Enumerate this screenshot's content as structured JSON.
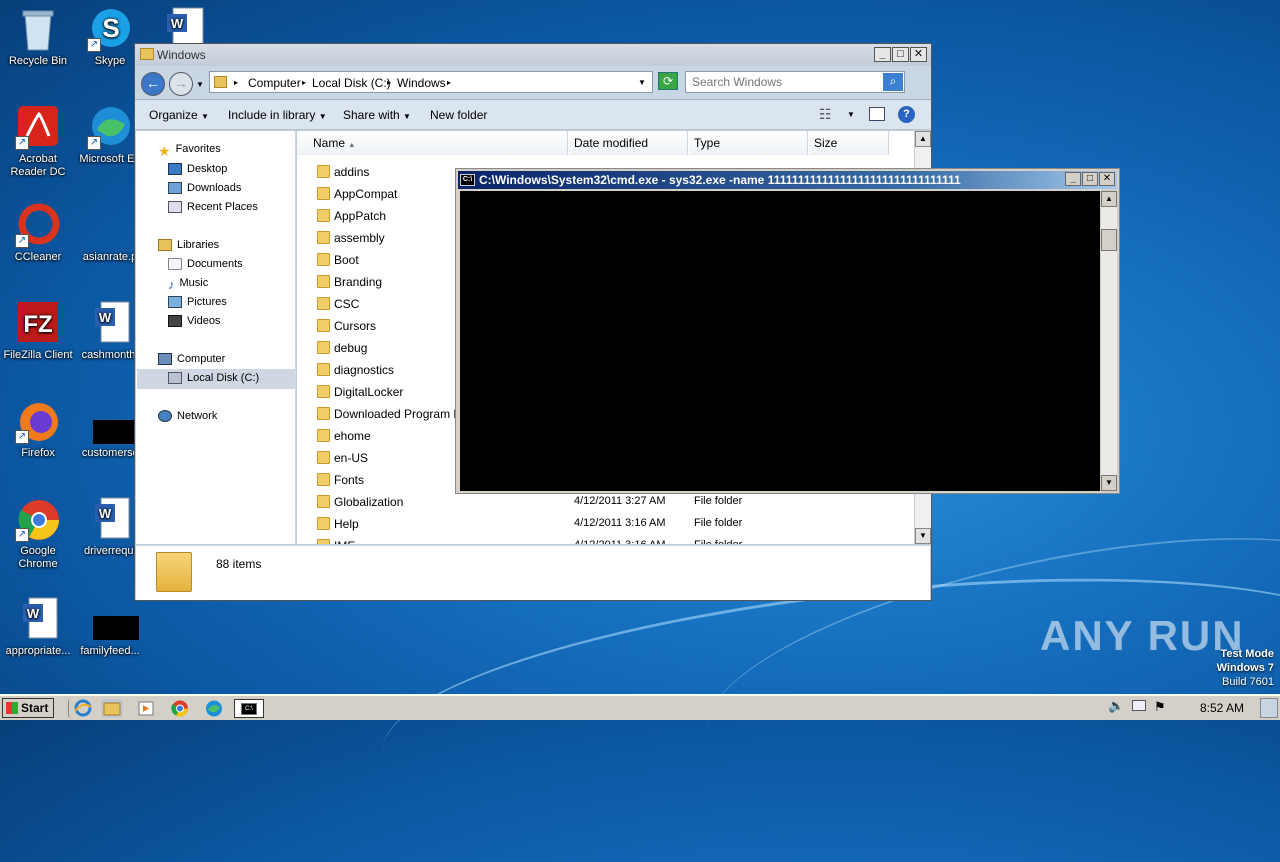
{
  "desktop": {
    "icons": [
      {
        "label": "Recycle Bin"
      },
      {
        "label": "Skype"
      },
      {
        "label": "Acrobat Reader DC"
      },
      {
        "label": "Microsoft Ed"
      },
      {
        "label": "CCleaner"
      },
      {
        "label": "asianrate.p"
      },
      {
        "label": "FileZilla Client"
      },
      {
        "label": "cashmonth."
      },
      {
        "label": "Firefox"
      },
      {
        "label": "customersc"
      },
      {
        "label": "Google Chrome"
      },
      {
        "label": "driverrequi"
      },
      {
        "label": "appropriate..."
      },
      {
        "label": "familyfeed..."
      }
    ]
  },
  "explorer": {
    "title": "Windows",
    "address": {
      "crumbs": [
        "Computer",
        "Local Disk (C:)",
        "Windows"
      ]
    },
    "search_placeholder": "Search Windows",
    "toolbar": {
      "organize": "Organize",
      "include": "Include in library",
      "share": "Share with",
      "new_folder": "New folder"
    },
    "nav": {
      "favorites": "Favorites",
      "desktop": "Desktop",
      "downloads": "Downloads",
      "recent": "Recent Places",
      "libraries": "Libraries",
      "documents": "Documents",
      "music": "Music",
      "pictures": "Pictures",
      "videos": "Videos",
      "computer": "Computer",
      "local_disk": "Local Disk (C:)",
      "network": "Network"
    },
    "columns": {
      "name": "Name",
      "date": "Date modified",
      "type": "Type",
      "size": "Size"
    },
    "files": [
      {
        "name": "addins",
        "date": "",
        "type": ""
      },
      {
        "name": "AppCompat",
        "date": "",
        "type": ""
      },
      {
        "name": "AppPatch",
        "date": "",
        "type": ""
      },
      {
        "name": "assembly",
        "date": "",
        "type": ""
      },
      {
        "name": "Boot",
        "date": "",
        "type": ""
      },
      {
        "name": "Branding",
        "date": "",
        "type": ""
      },
      {
        "name": "CSC",
        "date": "",
        "type": ""
      },
      {
        "name": "Cursors",
        "date": "",
        "type": ""
      },
      {
        "name": "debug",
        "date": "",
        "type": ""
      },
      {
        "name": "diagnostics",
        "date": "",
        "type": ""
      },
      {
        "name": "DigitalLocker",
        "date": "",
        "type": ""
      },
      {
        "name": "Downloaded Program Files",
        "date": "",
        "type": ""
      },
      {
        "name": "ehome",
        "date": "",
        "type": ""
      },
      {
        "name": "en-US",
        "date": "",
        "type": ""
      },
      {
        "name": "Fonts",
        "date": "",
        "type": ""
      },
      {
        "name": "Globalization",
        "date": "4/12/2011 3:27 AM",
        "type": "File folder"
      },
      {
        "name": "Help",
        "date": "4/12/2011 3:16 AM",
        "type": "File folder"
      },
      {
        "name": "IME",
        "date": "4/12/2011 3:16 AM",
        "type": "File folder"
      }
    ],
    "status": "88 items"
  },
  "cmd": {
    "title": "C:\\Windows\\System32\\cmd.exe - sys32.exe  -name 11111111111111111111111111111111"
  },
  "taskbar": {
    "start": "Start",
    "clock": "8:52 AM"
  },
  "watermark": "ANY RUN",
  "testmode": {
    "line1": "Test Mode",
    "line2": "Windows 7",
    "line3": "Build 7601"
  }
}
